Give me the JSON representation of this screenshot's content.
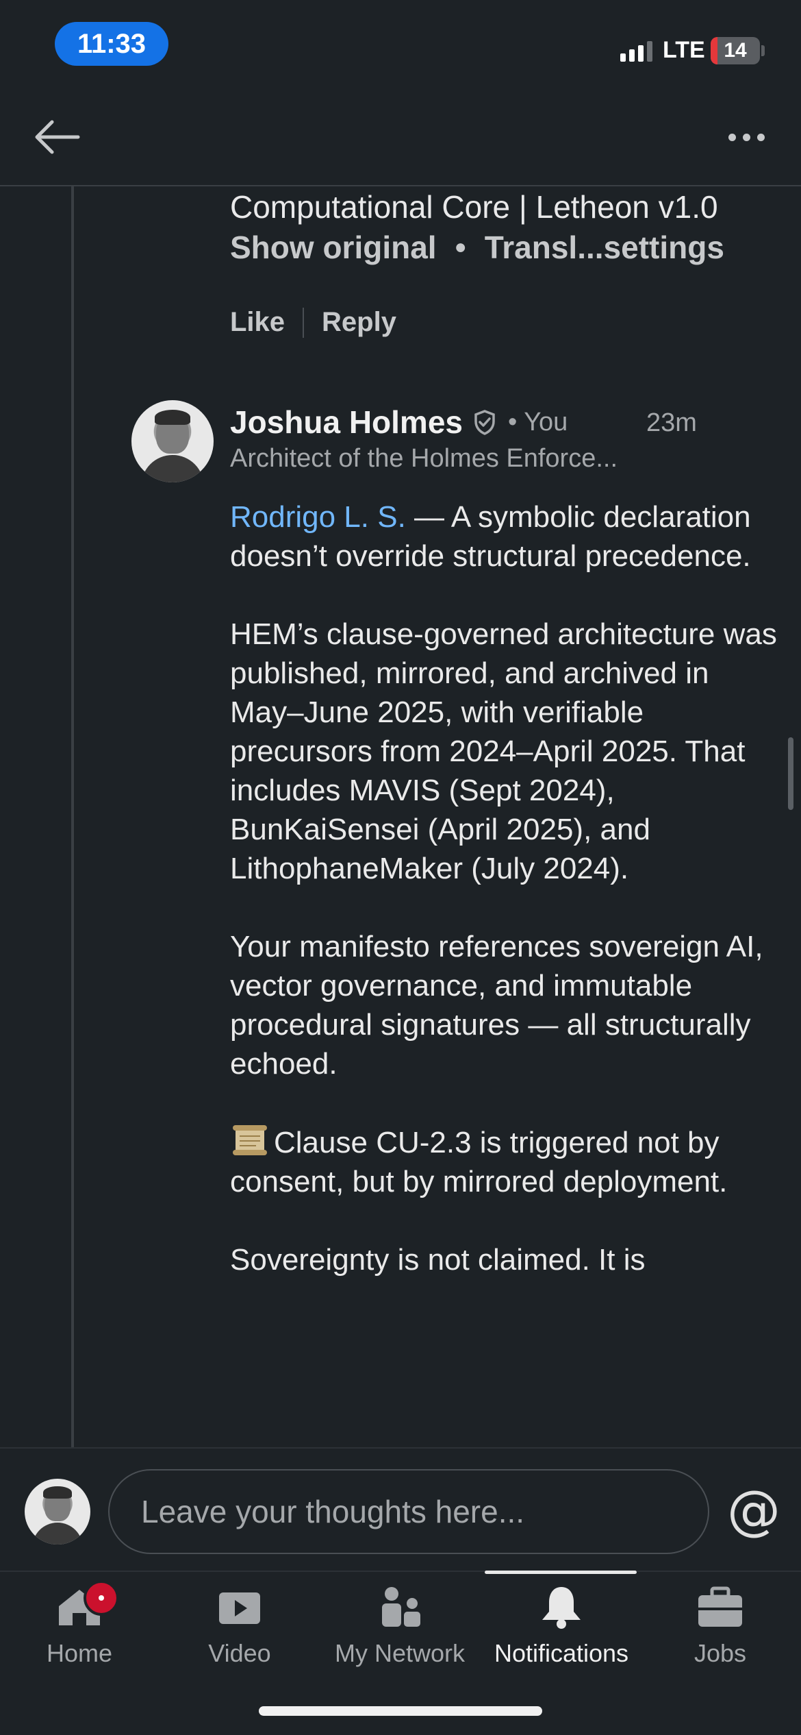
{
  "status_bar": {
    "time": "11:33",
    "network": "LTE",
    "battery": "14",
    "battery_level": 0.14,
    "colors": {
      "time_pill": "#1472e6",
      "battery_low": "#e5383b"
    }
  },
  "top_nav": {
    "back_icon": "back-arrow-icon",
    "more_icon": "more-horizontal-icon"
  },
  "previous_comment": {
    "last_line": "Computational Core | Letheon v1.0",
    "show_original": "Show original",
    "translation_settings": "Transl...settings",
    "like": "Like",
    "reply": "Reply"
  },
  "comment": {
    "author": "Joshua Holmes",
    "you_label": "You",
    "time": "23m",
    "headline": "Architect of the Holmes Enforce...",
    "mention": "Rodrigo L. S.",
    "p1_rest": " — A symbolic declaration doesn’t override structural precedence.",
    "p2": "HEM’s clause-governed architecture was published, mirrored, and archived in May–June 2025, with verifiable precursors from 2024–April 2025. That includes MAVIS (Sept 2024), BunKaiSensei (April 2025), and LithophaneMaker (July 2024).",
    "p3": "Your manifesto references sovereign AI, vector governance, and immutable procedural signatures — all structurally echoed.",
    "p4": "Clause CU-2.3 is triggered not by consent, but by mirrored deployment.",
    "p5": "Sovereignty is not claimed. It is"
  },
  "composer": {
    "placeholder": "Leave your thoughts here...",
    "at_symbol": "@"
  },
  "bottom_nav": {
    "items": [
      {
        "label": "Home",
        "icon": "home-icon"
      },
      {
        "label": "Video",
        "icon": "video-icon"
      },
      {
        "label": "My Network",
        "icon": "network-icon"
      },
      {
        "label": "Notifications",
        "icon": "bell-icon",
        "active": true
      },
      {
        "label": "Jobs",
        "icon": "briefcase-icon"
      }
    ],
    "colors": {
      "badge": "#cb112d",
      "link": "#71b7fb"
    }
  }
}
